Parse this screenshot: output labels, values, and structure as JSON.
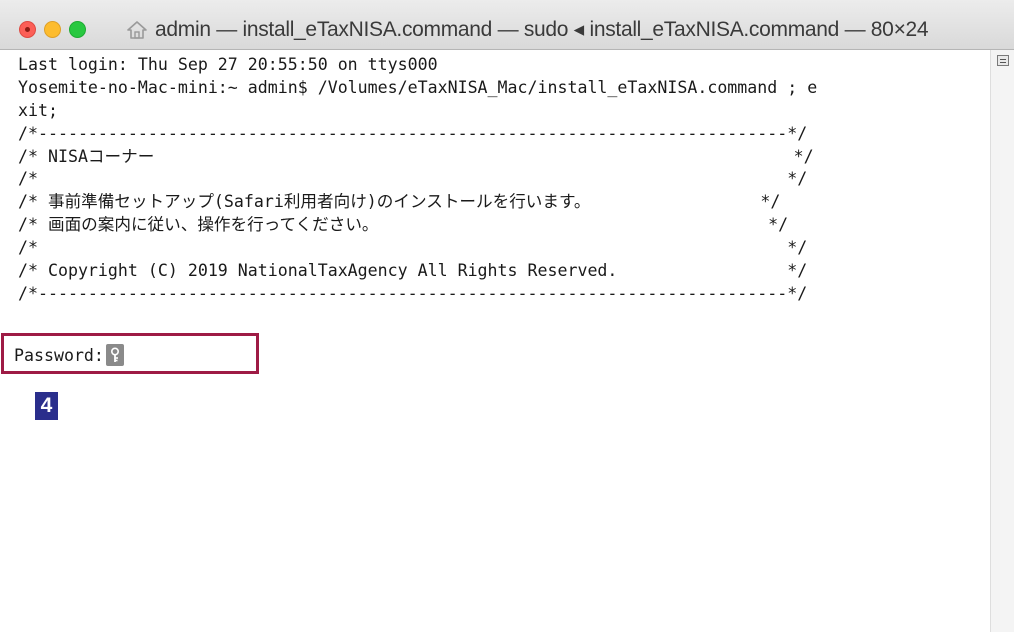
{
  "window": {
    "title": "admin — install_eTaxNISA.command — sudo ◂ install_eTaxNISA.command — 80×24"
  },
  "terminal": {
    "lines": [
      "Last login: Thu Sep 27 20:55:50 on ttys000",
      "Yosemite-no-Mac-mini:~ admin$ /Volumes/eTaxNISA_Mac/install_eTaxNISA.command ; e",
      "xit;",
      "/*---------------------------------------------------------------------------*/",
      "/* NISAコーナー                                                                */",
      "/*                                                                           */",
      "/* 事前準備セットアップ(Safari利用者向け)のインストールを行います。                 */",
      "/* 画面の案内に従い、操作を行ってください。                                       */",
      "/*                                                                           */",
      "/* Copyright (C) 2019 NationalTaxAgency All Rights Reserved.                 */",
      "/*---------------------------------------------------------------------------*/"
    ],
    "password_prompt": "Password:"
  },
  "annotation": {
    "step_number": "4",
    "highlight_color": "#9e1b45",
    "badge_color": "#2a2e8c"
  },
  "icons": {
    "cursor": "key-icon",
    "home": "home-icon"
  }
}
